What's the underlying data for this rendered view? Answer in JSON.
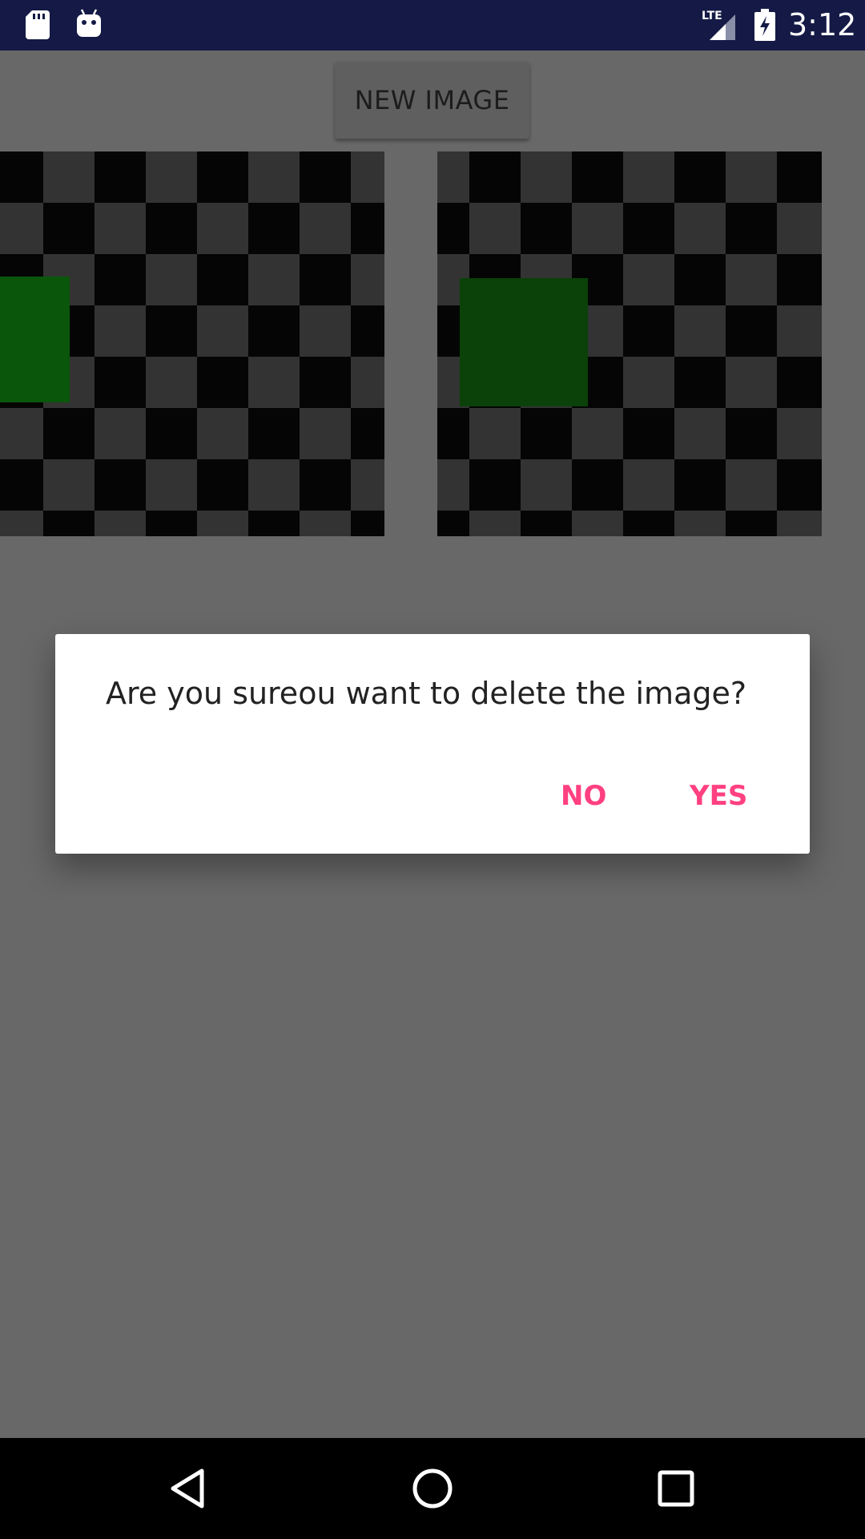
{
  "status_bar": {
    "time": "3:12",
    "network_label": "LTE",
    "icons": [
      "sd-card-icon",
      "android-icon",
      "lte-signal-icon",
      "battery-charging-icon"
    ]
  },
  "toolbar": {
    "new_image_label": "NEW IMAGE"
  },
  "images": [
    {
      "name": "left-image",
      "shape_color": "#0a560a"
    },
    {
      "name": "right-image",
      "shape_color": "#0a420a"
    }
  ],
  "dialog": {
    "message": "Are you sureou want to delete the image?",
    "no_label": "NO",
    "yes_label": "YES",
    "accent_color": "#ff4081"
  },
  "nav_bar": {
    "icons": [
      "back-icon",
      "home-icon",
      "recents-icon"
    ]
  },
  "colors": {
    "status_bar": "#141a45",
    "scrim_background": "#686868",
    "dialog_background": "#ffffff"
  }
}
